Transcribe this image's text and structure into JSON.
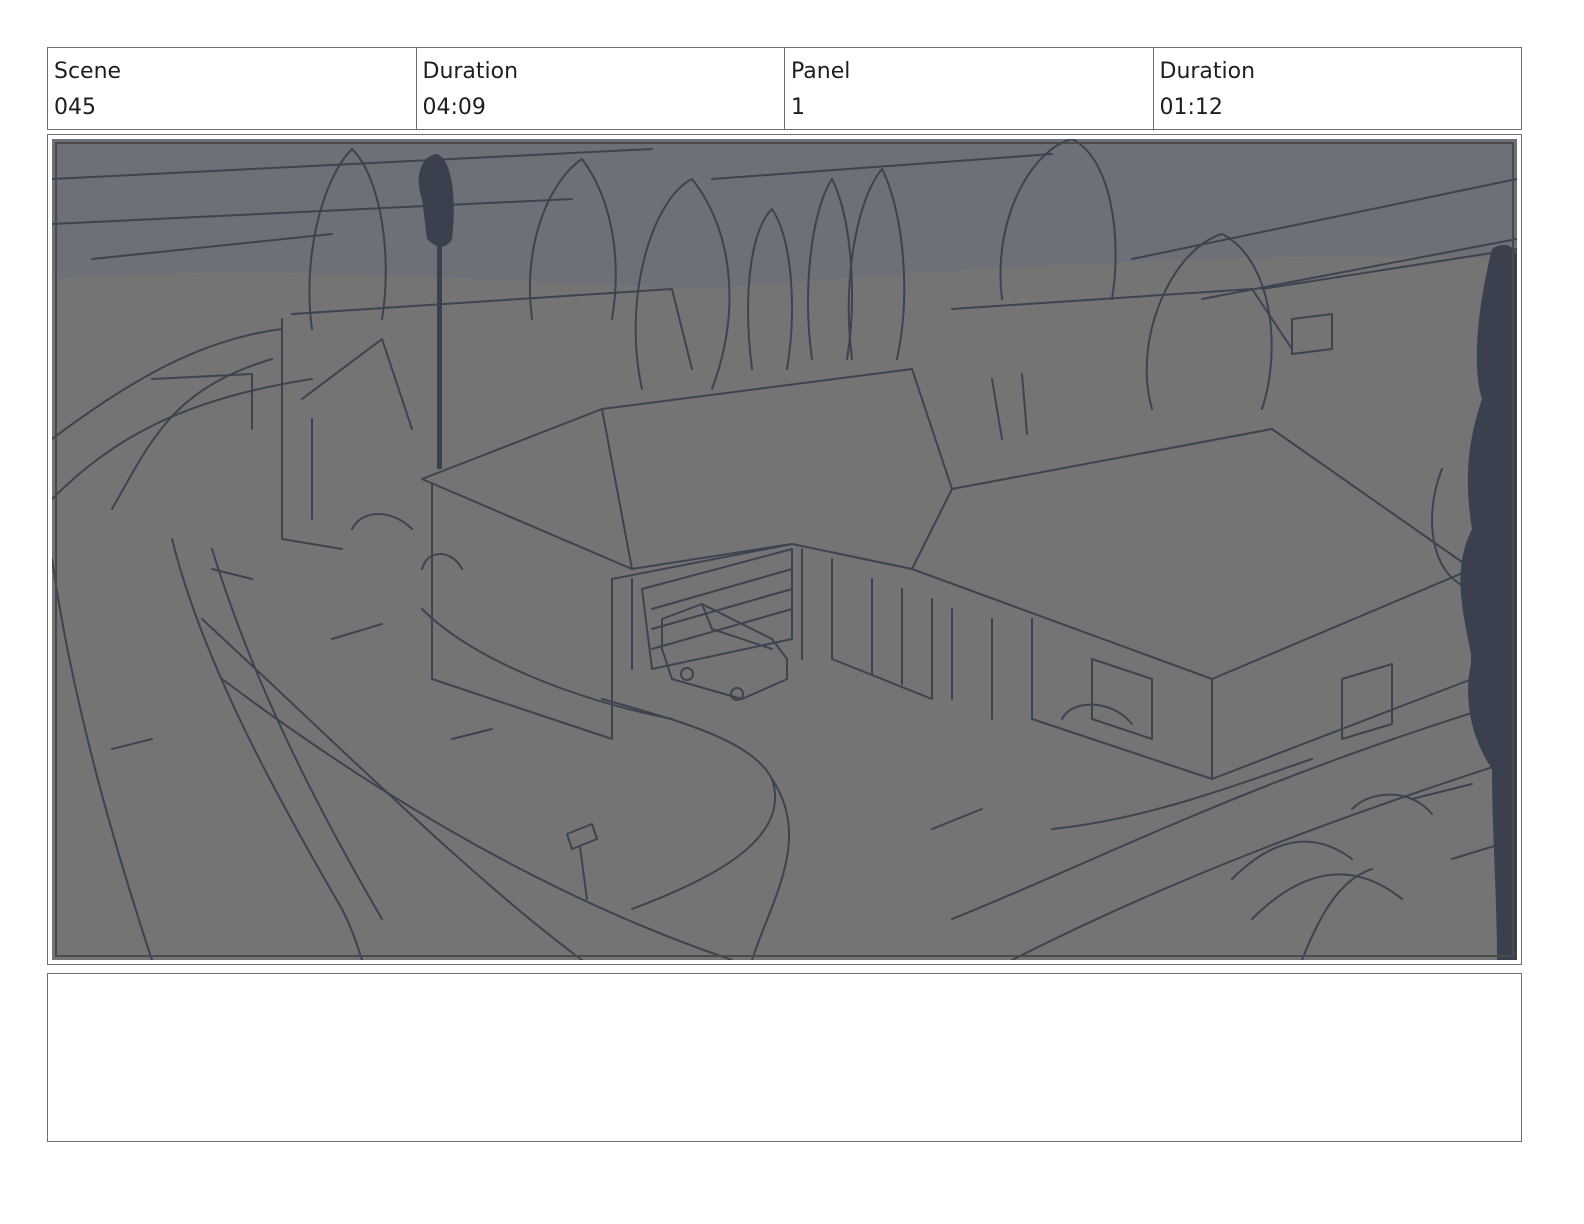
{
  "header": {
    "cells": [
      {
        "label": "Scene",
        "value": "045"
      },
      {
        "label": "Duration",
        "value": "04:09"
      },
      {
        "label": "Panel",
        "value": "1"
      },
      {
        "label": "Duration",
        "value": "01:12"
      }
    ]
  },
  "panel": {
    "colors": {
      "background": "#747474",
      "sky": "#6d7078",
      "line": "#3d4350",
      "silhouette": "#3a404d"
    }
  },
  "notes": {
    "text": ""
  }
}
